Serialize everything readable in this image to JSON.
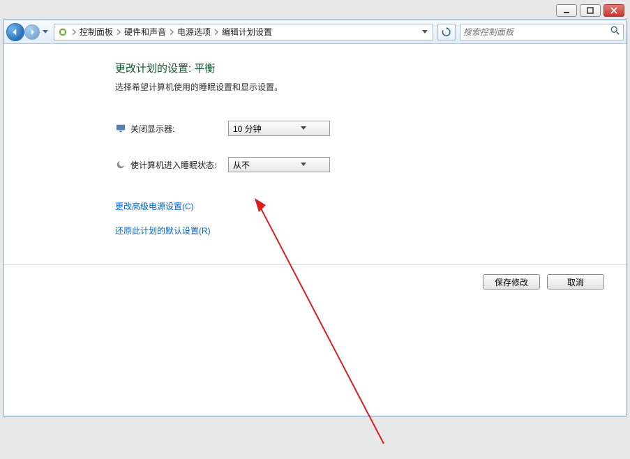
{
  "breadcrumbs": [
    "控制面板",
    "硬件和声音",
    "电源选项",
    "编辑计划设置"
  ],
  "search": {
    "placeholder": "搜索控制面板"
  },
  "page": {
    "title": "更改计划的设置: 平衡",
    "subtitle": "选择希望计算机使用的睡眠设置和显示设置。"
  },
  "option_display": {
    "label": "关闭显示器:",
    "value": "10 分钟"
  },
  "option_sleep": {
    "label": "使计算机进入睡眠状态:",
    "value": "从不"
  },
  "link_advanced": "更改高级电源设置(C)",
  "link_restore": "还原此计划的默认设置(R)",
  "btn_save": "保存修改",
  "btn_cancel": "取消"
}
